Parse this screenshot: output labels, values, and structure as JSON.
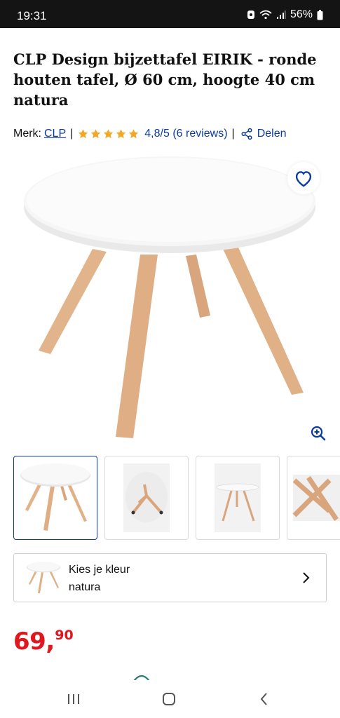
{
  "status_bar": {
    "time": "19:31",
    "battery": "56%"
  },
  "product": {
    "title": "CLP Design bijzettafel EIRIK - ronde houten tafel, Ø 60 cm, hoogte 40 cm natura",
    "brand_prefix": "Merk:",
    "brand": "CLP",
    "rating_stars": 5,
    "rating_text": "4,8/5 (6 reviews)",
    "share_label": "Delen"
  },
  "gallery": {
    "thumbnail_count_visible": 4,
    "active_index": 0
  },
  "color_selector": {
    "label": "Kies je kleur",
    "value": "natura"
  },
  "price": {
    "main": "69",
    "comma": ",",
    "cents": "90"
  },
  "colors": {
    "accent": "#0b3a9e",
    "price": "#e0171f",
    "star": "#f5a623",
    "wood": "#e2b48c",
    "tabletop": "#f4f4f4"
  },
  "icons": {
    "favorite": "heart-outline-icon",
    "zoom": "zoom-in-icon",
    "share": "share-icon",
    "chevron": "chevron-right-icon"
  }
}
